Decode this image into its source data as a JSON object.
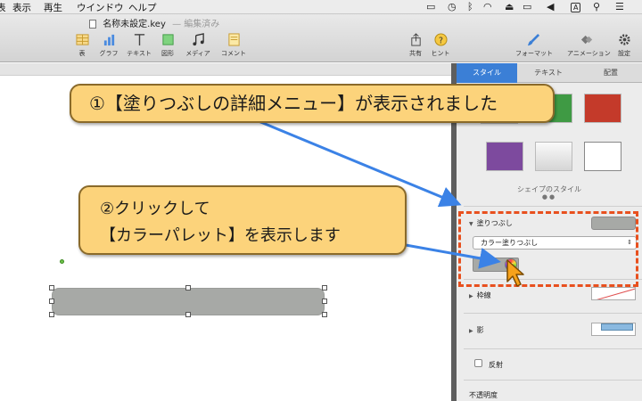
{
  "menubar": {
    "items": [
      "表",
      "表示",
      "再生",
      "ウインドウ",
      "ヘルプ"
    ],
    "status_icons": [
      "airplay-icon",
      "time-machine-icon",
      "bluetooth-icon",
      "wifi-icon",
      "eject-icon",
      "battery-icon",
      "volume-icon",
      "input-a-icon",
      "search-icon",
      "list-icon"
    ],
    "input_label": "A"
  },
  "window": {
    "title": "名称未設定.key",
    "subtitle": "— 編集済み"
  },
  "toolbar": {
    "table": "表",
    "chart": "グラフ",
    "text": "テキスト",
    "shape": "図形",
    "media": "メディア",
    "comment": "コメント",
    "share": "共有",
    "tips": "ヒント",
    "format": "フォーマット",
    "animate": "アニメーション",
    "settings": "設定"
  },
  "inspector": {
    "tabs": [
      "スタイル",
      "テキスト",
      "配置"
    ],
    "style_caption": "シェイプのスタイル",
    "page_dots": "●●",
    "fill": {
      "title": "塗りつぶし",
      "type_value": "カラー塗りつぶし",
      "color": "#a7a9a6"
    },
    "stroke": {
      "title": "枠線"
    },
    "shadow": {
      "title": "影"
    },
    "reflection": {
      "title": "反射"
    },
    "opacity": {
      "title": "不透明度"
    },
    "swatches": [
      "#2f6fb8",
      "#3f9a44",
      "#c43a2a",
      "#7d4a9e",
      "#e6e6e6",
      "#ffffff"
    ]
  },
  "callouts": {
    "step1": "①【塗りつぶしの詳細メニュー】が表示されました",
    "step2_line1": "②クリックして",
    "step2_line2": "【カラーパレット】を表示します"
  },
  "colors": {
    "callout_bg": "#fcd37b",
    "arrow": "#3b82e6",
    "highlight": "#e8501e",
    "accent_tab": "#3b7fd6"
  }
}
